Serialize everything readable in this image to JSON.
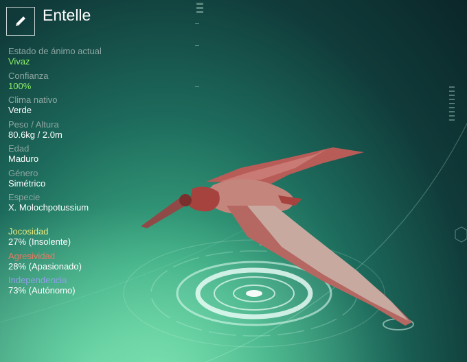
{
  "creature": {
    "name": "Entelle"
  },
  "stats": [
    {
      "label": "Estado de ánimo actual",
      "value": "Vivaz"
    },
    {
      "label": "Confianza",
      "value": "100%"
    },
    {
      "label": "Clima nativo",
      "value": "Verde"
    },
    {
      "label": "Peso / Altura",
      "value": "80.6kg / 2.0m"
    },
    {
      "label": "Edad",
      "value": "Maduro"
    },
    {
      "label": "Género",
      "value": "Simétrico"
    },
    {
      "label": "Especie",
      "value": "X. Molochpotussium"
    }
  ],
  "traits": [
    {
      "label": "Jocosidad",
      "value": "27% (Insolente)",
      "color": "#e8e87a"
    },
    {
      "label": "Agresividad",
      "value": "28% (Apasionado)",
      "color": "#e87a62"
    },
    {
      "label": "Independencia",
      "value": "73% (Autónomo)",
      "color": "#8fa0e8"
    }
  ],
  "colors": {
    "accent_green": "#8df06a",
    "label_gray": "#8fa7a3"
  },
  "icons": {
    "edit": "pencil-icon"
  }
}
